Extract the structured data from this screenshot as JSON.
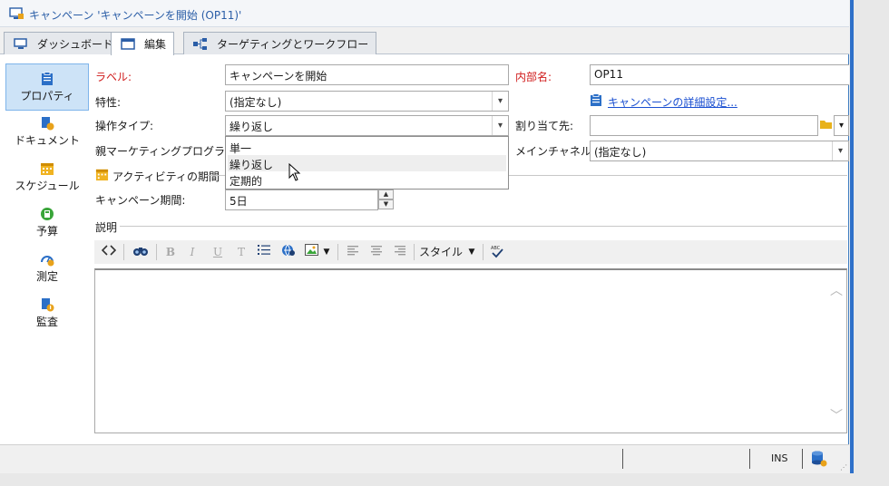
{
  "window": {
    "title": "キャンペーン 'キャンペーンを開始 (OP11)'"
  },
  "tabs": [
    {
      "label": "ダッシュボード",
      "icon": "monitor-icon"
    },
    {
      "label": "編集",
      "icon": "window-icon",
      "active": true
    },
    {
      "label": "ターゲティングとワークフロー",
      "icon": "workflow-icon"
    }
  ],
  "sidebar": {
    "items": [
      {
        "label": "プロパティ",
        "icon": "clipboard-icon",
        "selected": true
      },
      {
        "label": "ドキュメント",
        "icon": "document-icon"
      },
      {
        "label": "スケジュール",
        "icon": "calendar-icon"
      },
      {
        "label": "予算",
        "icon": "calculator-icon"
      },
      {
        "label": "測定",
        "icon": "gauge-icon"
      },
      {
        "label": "監査",
        "icon": "audit-icon"
      }
    ]
  },
  "form": {
    "label_caption": "ラベル:",
    "label_value": "キャンペーンを開始",
    "internal_name_caption": "内部名:",
    "internal_name_value": "OP11",
    "nature_caption": "特性:",
    "nature_value": "(指定なし)",
    "advanced_link": "キャンペーンの詳細設定...",
    "operation_type_caption": "操作タイプ:",
    "operation_type_value": "繰り返し",
    "assignee_caption": "割り当て先:",
    "assignee_value": "",
    "parent_program_caption": "親マーケティングプログラム:",
    "main_channel_caption": "メインチャネル:",
    "main_channel_value": "(指定なし)",
    "activity_period_section": "アクティビティの期間",
    "campaign_period_caption": "キャンペーン期間:",
    "campaign_period_value": "5日",
    "description_section": "説明"
  },
  "dropdown": {
    "options": [
      "単一",
      "繰り返し",
      "定期的"
    ],
    "highlighted": "繰り返し"
  },
  "editor_toolbar": {
    "style_label": "スタイル"
  },
  "statusbar": {
    "ins": "INS"
  },
  "colors": {
    "accent": "#2e70c9",
    "required_label": "#d01c1c",
    "link": "#1a4fd1",
    "sidebar_selected": "#cde3f7"
  }
}
